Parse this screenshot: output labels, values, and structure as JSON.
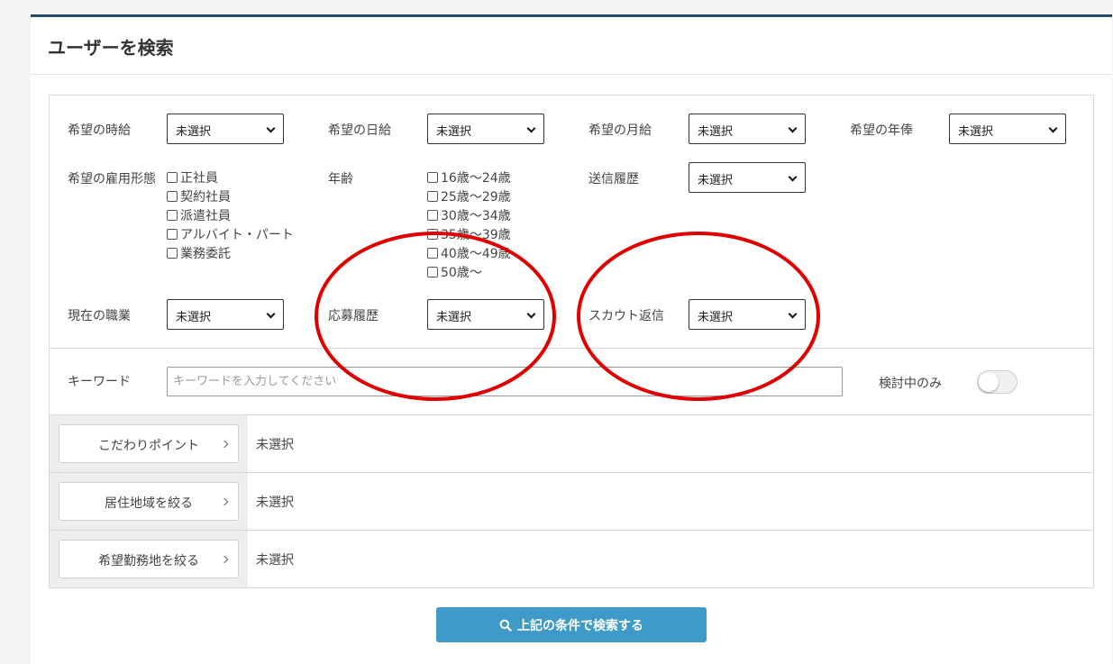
{
  "page": {
    "title": "ユーザーを検索"
  },
  "filters": {
    "hourly_wage": {
      "label": "希望の時給",
      "value": "未選択"
    },
    "daily_wage": {
      "label": "希望の日給",
      "value": "未選択"
    },
    "monthly_wage": {
      "label": "希望の月給",
      "value": "未選択"
    },
    "annual_salary": {
      "label": "希望の年俸",
      "value": "未選択"
    },
    "employment_type": {
      "label": "希望の雇用形態",
      "options": [
        "正社員",
        "契約社員",
        "派遣社員",
        "アルバイト・パート",
        "業務委託"
      ]
    },
    "age": {
      "label": "年齢",
      "options": [
        "16歳～24歳",
        "25歳～29歳",
        "30歳～34歳",
        "35歳～39歳",
        "40歳～49歳",
        "50歳～"
      ]
    },
    "send_history": {
      "label": "送信履歴",
      "value": "未選択"
    },
    "current_job": {
      "label": "現在の職業",
      "value": "未選択"
    },
    "application_history": {
      "label": "応募履歴",
      "value": "未選択"
    },
    "scout_reply": {
      "label": "スカウト返信",
      "value": "未選択"
    }
  },
  "keyword": {
    "label": "キーワード",
    "placeholder": "キーワードを入力してください",
    "consider_only_label": "検討中のみ",
    "consider_only_on": false
  },
  "detail_filters": [
    {
      "button": "こだわりポイント",
      "value": "未選択"
    },
    {
      "button": "居住地域を絞る",
      "value": "未選択"
    },
    {
      "button": "希望勤務地を絞る",
      "value": "未選択"
    }
  ],
  "search_button": {
    "label": "上記の条件で検索する"
  },
  "colors": {
    "header_border": "#244a6b",
    "search_button": "#3e9bc9",
    "annotation": "#e00000"
  }
}
